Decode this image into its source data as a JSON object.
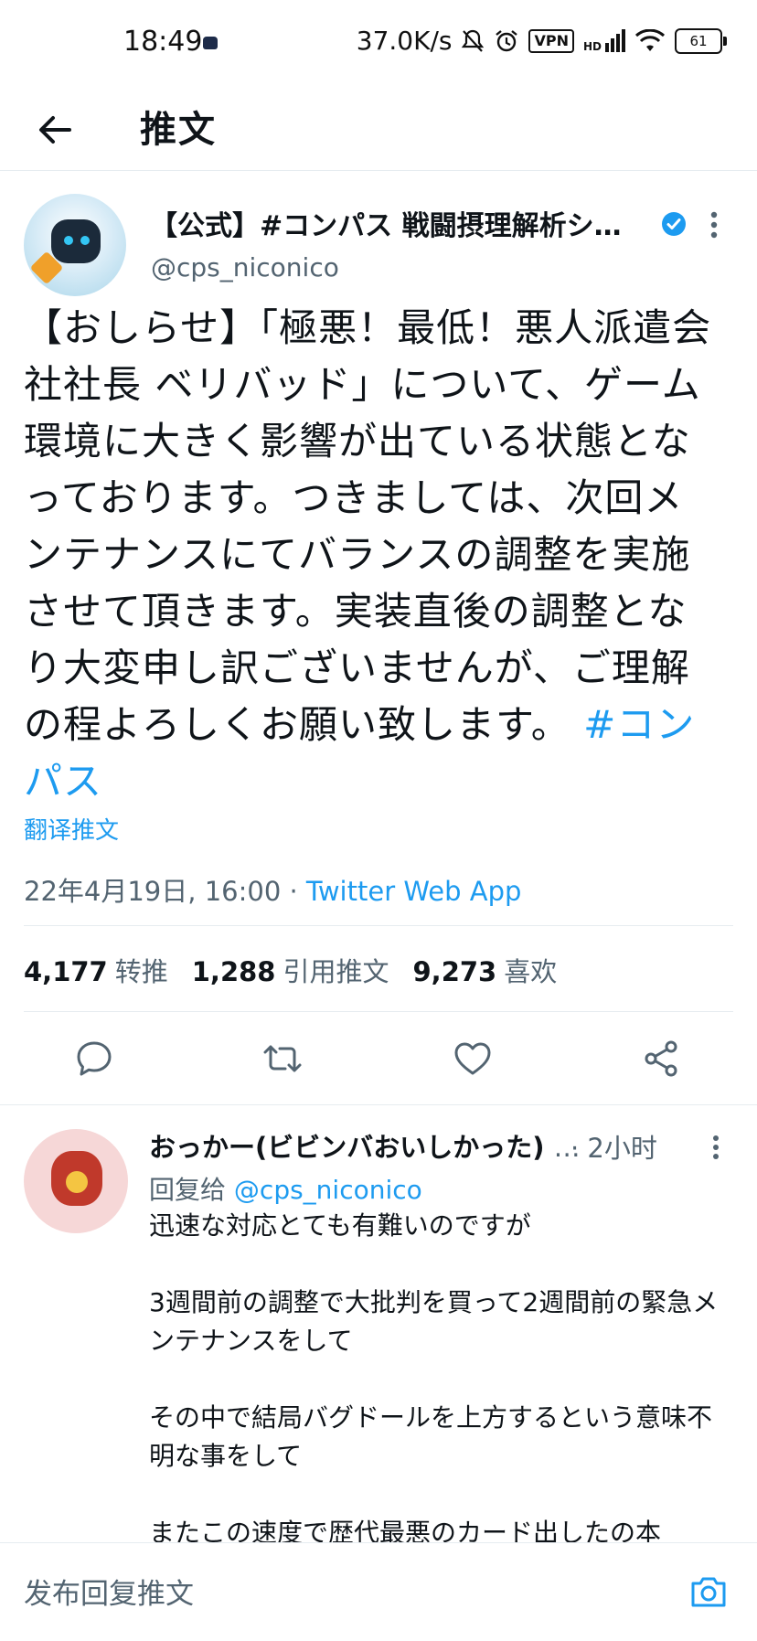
{
  "status_bar": {
    "time": "18:49",
    "network_speed": "37.0K/s",
    "vpn": "VPN",
    "network_type": "HD",
    "battery": "61",
    "icons": [
      "mute-icon",
      "alarm-icon",
      "vpn-icon",
      "signal-icon",
      "wifi-icon",
      "battery-icon"
    ]
  },
  "header": {
    "title": "推文"
  },
  "tweet": {
    "author_name": "【公式】#コンパス 戦闘摂理解析シ…",
    "author_handle": "@cps_niconico",
    "verified": true,
    "text": "【おしらせ】「極悪！最低！悪人派遣会社社長 ベリバッド」について、ゲーム環境に大きく影響が出ている状態となっております。つきましては、次回メンテナンスにてバランスの調整を実施させて頂きます。実装直後の調整となり大変申し訳ございませんが、ご理解の程よろしくお願い致します。",
    "hashtag": "#コンパス",
    "translate_label": "翻译推文",
    "timestamp": "22年4月19日, 16:00",
    "meta_separator": " · ",
    "source": "Twitter Web App",
    "retweets": "4,177",
    "retweets_label": "转推",
    "quotes": "1,288",
    "quotes_label": "引用推文",
    "likes": "9,273",
    "likes_label": "喜欢"
  },
  "reply": {
    "author_name": "おっかー(ビビンバおいしかった)",
    "ellipsis": "…",
    "time": "· 2小时",
    "reply_to_label": "回复给",
    "reply_to_handle": "@cps_niconico",
    "text": "迅速な対応とても有難いのですが\n\n3週間前の調整で大批判を買って2週間前の緊急メンテナンスをして\n\nその中で結局バグドールを上方するという意味不明な事をして\n\nまたこの速度で歴代最悪のカード出したの本"
  },
  "composer": {
    "placeholder": "发布回复推文"
  },
  "colors": {
    "accent": "#1d9bf0",
    "text": "#0f1419",
    "secondary": "#536471",
    "divider": "#e6ecf0"
  }
}
